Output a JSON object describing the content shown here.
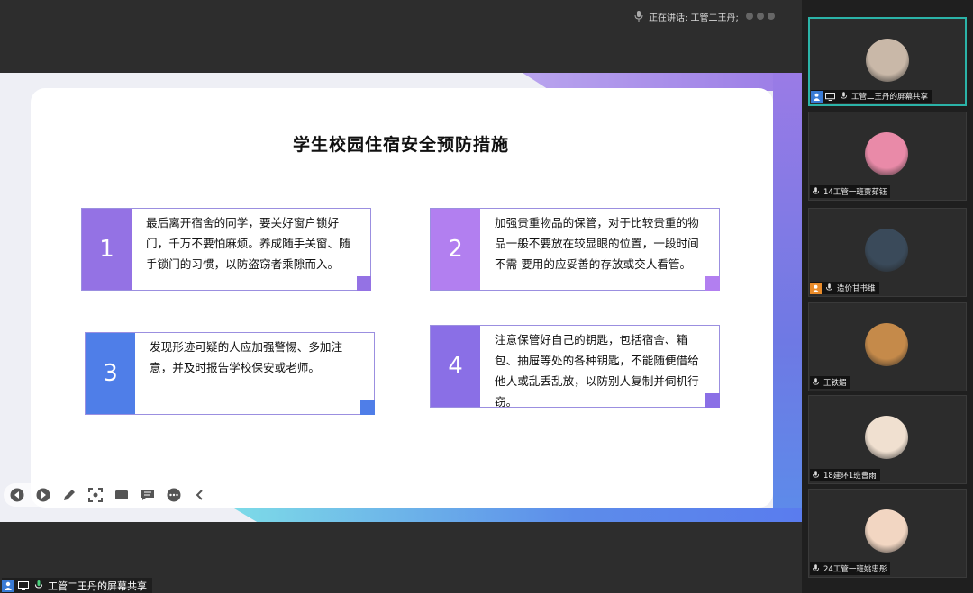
{
  "topbar": {
    "speaking_text": "正在讲话: 工管二王丹;"
  },
  "slide": {
    "title": "学生校园住宿安全预防措施",
    "items": [
      {
        "num": "1",
        "text": "最后离开宿舍的同学，要关好窗户锁好门，千万不要怕麻烦。养成随手关窗、随手锁门的习惯，以防盗窃者乘隙而入。",
        "color": "#9472e4"
      },
      {
        "num": "2",
        "text": "加强贵重物品的保管，对于比较贵重的物品一般不要放在较显眼的位置，一段时间不需 要用的应妥善的存放或交人看管。",
        "color": "#b27ff0"
      },
      {
        "num": "3",
        "text": "发现形迹可疑的人应加强警惕、多加注意，并及时报告学校保安或老师。",
        "color": "#4f7ee8"
      },
      {
        "num": "4",
        "text": "注意保管好自己的钥匙，包括宿舍、箱包、抽屉等处的各种钥匙，不能随便借给他人或乱丢乱放，以防别人复制并伺机行窃。",
        "color": "#8a6fe6"
      }
    ]
  },
  "toolbar": {
    "tools": [
      "prev-icon",
      "next-icon",
      "pen-icon",
      "screenshot-icon",
      "camera-icon",
      "comment-icon",
      "more-icon",
      "collapse-icon"
    ]
  },
  "share_label": "工管二王丹的屏幕共享",
  "participants": [
    {
      "name": "工管二王丹的屏幕共享",
      "icons": [
        "user-icon",
        "screen-icon",
        "mic-icon"
      ],
      "active": true,
      "avatar_color": "#c9b8a8"
    },
    {
      "name": "14工管一班贾茹钰",
      "icons": [
        "mic-icon"
      ],
      "active": false,
      "avatar_color": "#e98aa8"
    },
    {
      "name": "造价甘书维",
      "icons": [
        "user-icon",
        "mic-icon"
      ],
      "active": false,
      "avatar_color": "#3a4a5a"
    },
    {
      "name": "王铁媚",
      "icons": [
        "mic-icon"
      ],
      "active": false,
      "avatar_color": "#c58a4a"
    },
    {
      "name": "18建环1班曹雨",
      "icons": [
        "mic-icon"
      ],
      "active": false,
      "avatar_color": "#f0e0d0"
    },
    {
      "name": "24工管一班姚忠彤",
      "icons": [
        "mic-icon"
      ],
      "active": false,
      "avatar_color": "#f2d6c2"
    }
  ]
}
